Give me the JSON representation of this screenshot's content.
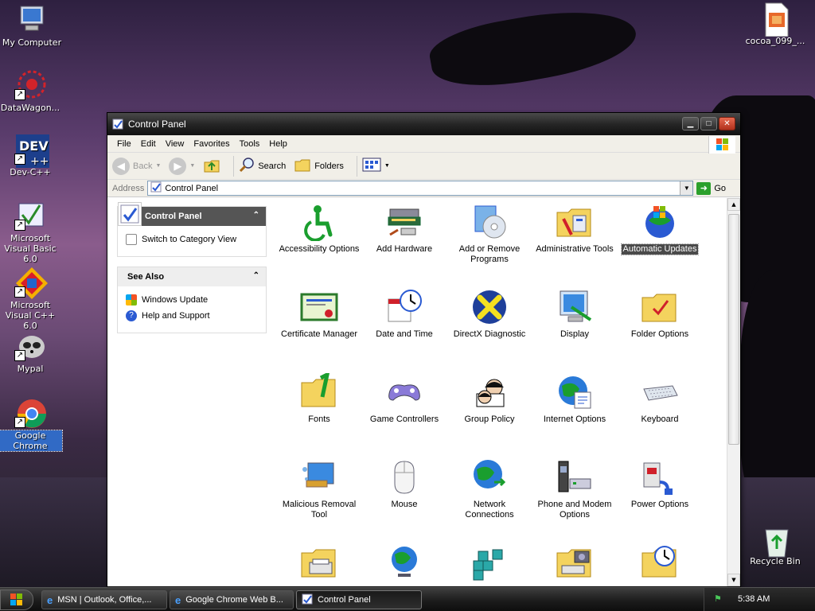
{
  "desktop": {
    "icons": [
      {
        "label": "My Computer"
      },
      {
        "label": "DataWagon..."
      },
      {
        "label": "Dev-C++"
      },
      {
        "label": "Microsoft Visual Basic 6.0"
      },
      {
        "label": "Microsoft Visual C++ 6.0"
      },
      {
        "label": "Mypal"
      },
      {
        "label": "Google Chrome"
      },
      {
        "label": "cocoa_099_..."
      },
      {
        "label": "Recycle Bin"
      }
    ]
  },
  "window": {
    "title": "Control Panel",
    "menu": [
      "File",
      "Edit",
      "View",
      "Favorites",
      "Tools",
      "Help"
    ],
    "toolbar": {
      "back": "Back",
      "search": "Search",
      "folders": "Folders"
    },
    "address": {
      "label": "Address",
      "value": "Control Panel",
      "go": "Go"
    },
    "left_panel": {
      "control_panel": {
        "title": "Control Panel",
        "link": "Switch to Category View"
      },
      "see_also": {
        "title": "See Also",
        "links": [
          "Windows Update",
          "Help and Support"
        ]
      }
    },
    "items": [
      {
        "label": "Accessibility Options",
        "icon": "accessibility-icon"
      },
      {
        "label": "Add Hardware",
        "icon": "add-hardware-icon"
      },
      {
        "label": "Add or Remove Programs",
        "icon": "add-remove-programs-icon"
      },
      {
        "label": "Administrative Tools",
        "icon": "administrative-tools-icon"
      },
      {
        "label": "Automatic Updates",
        "icon": "automatic-updates-icon"
      },
      {
        "label": "Certificate Manager",
        "icon": "certificate-icon"
      },
      {
        "label": "Date and Time",
        "icon": "calendar-clock-icon"
      },
      {
        "label": "DirectX Diagnostic",
        "icon": "directx-icon"
      },
      {
        "label": "Display",
        "icon": "display-icon"
      },
      {
        "label": "Folder Options",
        "icon": "folder-options-icon"
      },
      {
        "label": "Fonts",
        "icon": "fonts-folder-icon"
      },
      {
        "label": "Game Controllers",
        "icon": "gamepad-icon"
      },
      {
        "label": "Group Policy",
        "icon": "group-policy-icon"
      },
      {
        "label": "Internet Options",
        "icon": "globe-icon"
      },
      {
        "label": "Keyboard",
        "icon": "keyboard-icon"
      },
      {
        "label": "Malicious Removal Tool",
        "icon": "malicious-removal-icon"
      },
      {
        "label": "Mouse",
        "icon": "mouse-icon"
      },
      {
        "label": "Network Connections",
        "icon": "network-globe-icon"
      },
      {
        "label": "Phone and Modem Options",
        "icon": "phone-modem-icon"
      },
      {
        "label": "Power Options",
        "icon": "power-plug-icon"
      },
      {
        "label": "",
        "icon": "printer-folder-icon"
      },
      {
        "label": "",
        "icon": "globe-stand-icon"
      },
      {
        "label": "",
        "icon": "cubes-icon"
      },
      {
        "label": "",
        "icon": "scanner-camera-folder-icon"
      },
      {
        "label": "",
        "icon": "scheduled-tasks-icon"
      }
    ],
    "selected_item": "Automatic Updates"
  },
  "taskbar": {
    "tasks": [
      {
        "label": "MSN | Outlook, Office,..."
      },
      {
        "label": "Google Chrome Web B..."
      },
      {
        "label": "Control Panel",
        "active": true
      }
    ],
    "clock": "5:38 AM"
  }
}
